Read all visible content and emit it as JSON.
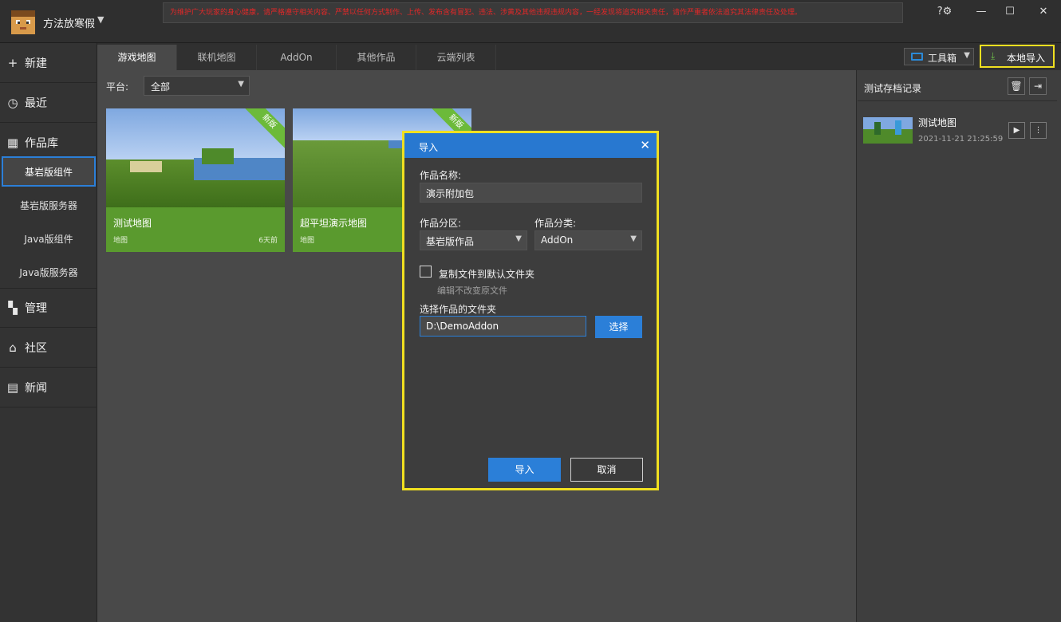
{
  "user": {
    "name": "方法放寒假",
    "caret": "▼"
  },
  "notice": "为维护广大玩家的身心健康，请严格遵守相关内容、严禁以任何方式制作、上传、发布含有冒犯、违法、涉黄及其他违规违规内容，一经发现将追究相关责任，请作严重者依法追究其法律责任及处理。",
  "window": {
    "help": "?⚙",
    "minimize": "—",
    "maximize": "☐",
    "close": "✕"
  },
  "sidebar": {
    "items": [
      {
        "label": "新建",
        "icon": "plus-icon",
        "glyph": "+"
      },
      {
        "label": "最近",
        "icon": "clock-icon",
        "glyph": "◷"
      },
      {
        "label": "作品库",
        "icon": "library-icon",
        "glyph": "▦"
      }
    ],
    "subitems": [
      "基岩版组件",
      "基岩版服务器",
      "Java版组件",
      "Java版服务器"
    ],
    "bottom": [
      {
        "label": "管理",
        "icon": "manage-icon",
        "glyph": "▚"
      },
      {
        "label": "社区",
        "icon": "home-icon",
        "glyph": "⌂"
      },
      {
        "label": "新闻",
        "icon": "news-icon",
        "glyph": "▤"
      }
    ]
  },
  "tabs": [
    "游戏地图",
    "联机地图",
    "AddOn",
    "其他作品",
    "云端列表"
  ],
  "toolbar": {
    "toolbox": "工具箱",
    "import": "本地导入",
    "caret": "▼",
    "import_glyph": "⤓"
  },
  "filter": {
    "label": "平台:",
    "value": "全部",
    "caret": "▼"
  },
  "cards": [
    {
      "title": "测试地图",
      "type": "地图",
      "age": "6天前",
      "badge": "新版"
    },
    {
      "title": "超平坦演示地图",
      "type": "地图",
      "age": "",
      "badge": "新版"
    }
  ],
  "right_panel": {
    "title": "测试存档记录",
    "delete_glyph": "🗑",
    "collapse_glyph": "⇥",
    "record": {
      "name": "测试地图",
      "time": "2021-11-21 21:25:59",
      "play_glyph": "▶",
      "more_glyph": "⋮"
    }
  },
  "dialog": {
    "title": "导入",
    "close": "✕",
    "name_label": "作品名称:",
    "name_value": "演示附加包",
    "zone_label": "作品分区:",
    "zone_value": "基岩版作品",
    "category_label": "作品分类:",
    "category_value": "AddOn",
    "caret": "▼",
    "copy_label": "复制文件到默认文件夹",
    "copy_hint": "编辑不改变原文件",
    "folder_label": "选择作品的文件夹",
    "folder_value": "D:\\DemoAddon",
    "choose": "选择",
    "ok": "导入",
    "cancel": "取消"
  },
  "colors": {
    "accent": "#2b7fd8",
    "highlight": "#f0e020",
    "card_green": "#5a9a2e",
    "notice_red": "#e02828"
  }
}
